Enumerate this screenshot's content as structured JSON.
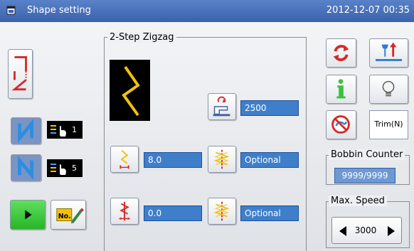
{
  "titlebar": {
    "title": "Shape setting",
    "datetime": "2012-12-07  00:35"
  },
  "left_panel": {
    "stitch_count_1": "1",
    "stitch_count_2": "5",
    "icons": [
      "zigzag-shape-icon",
      "n-pattern-icon",
      "n-pattern-mirror-icon",
      "play-icon",
      "number-edit-icon"
    ]
  },
  "pattern_group": {
    "title": "2-Step Zigzag",
    "speed_value": "2500",
    "width_value": "8.0",
    "width_option": "Optional",
    "offset_value": "0.0",
    "offset_option": "Optional"
  },
  "right_panel": {
    "trim_label": "Trim(N)",
    "bobbin_counter": {
      "title": "Bobbin Counter",
      "value": "9999/9999"
    },
    "max_speed": {
      "title": "Max. Speed",
      "value": "3000"
    }
  },
  "colors": {
    "titlebar": "#4a72bc",
    "field_blue": "#3f7fca",
    "icon_red": "#d62828",
    "icon_green": "#3cc23c",
    "zigzag_yellow": "#f0c20a"
  }
}
